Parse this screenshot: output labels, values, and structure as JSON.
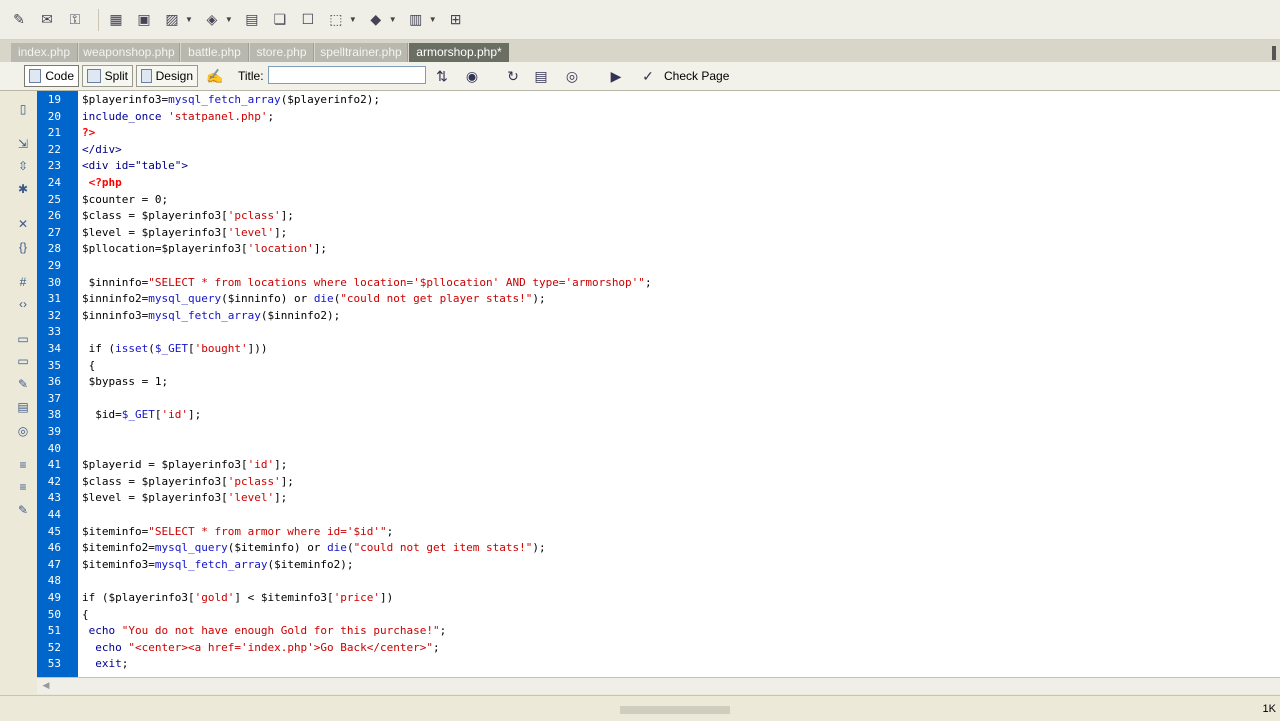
{
  "tabs": [
    {
      "label": "index.php"
    },
    {
      "label": "weaponshop.php"
    },
    {
      "label": "battle.php"
    },
    {
      "label": "store.php"
    },
    {
      "label": "spelltrainer.php"
    },
    {
      "label": "armorshop.php*"
    }
  ],
  "doc_toolbar": {
    "code_label": "Code",
    "split_label": "Split",
    "design_label": "Design",
    "title_label": "Title:",
    "title_value": "",
    "check_page_label": "Check Page"
  },
  "code": {
    "lines": [
      {
        "n": "19",
        "t": "$playerinfo3=mysql_fetch_array($playerinfo2);"
      },
      {
        "n": "20",
        "t": "include_once 'statpanel.php';"
      },
      {
        "n": "21",
        "t": "?>"
      },
      {
        "n": "22",
        "t": "</div>"
      },
      {
        "n": "23",
        "t": "<div id=\"table\">"
      },
      {
        "n": "24",
        "t": " <?php"
      },
      {
        "n": "25",
        "t": "$counter = 0;"
      },
      {
        "n": "26",
        "t": "$class = $playerinfo3['pclass'];"
      },
      {
        "n": "27",
        "t": "$level = $playerinfo3['level'];"
      },
      {
        "n": "28",
        "t": "$pllocation=$playerinfo3['location'];"
      },
      {
        "n": "29",
        "t": ""
      },
      {
        "n": "30",
        "t": " $inninfo=\"SELECT * from locations where location='$pllocation' AND type='armorshop'\";"
      },
      {
        "n": "31",
        "t": "$inninfo2=mysql_query($inninfo) or die(\"could not get player stats!\");"
      },
      {
        "n": "32",
        "t": "$inninfo3=mysql_fetch_array($inninfo2);"
      },
      {
        "n": "33",
        "t": ""
      },
      {
        "n": "34",
        "t": " if (isset($_GET['bought']))"
      },
      {
        "n": "35",
        "t": " {"
      },
      {
        "n": "36",
        "t": " $bypass = 1;"
      },
      {
        "n": "37",
        "t": ""
      },
      {
        "n": "38",
        "t": "  $id=$_GET['id'];"
      },
      {
        "n": "39",
        "t": ""
      },
      {
        "n": "40",
        "t": ""
      },
      {
        "n": "41",
        "t": "$playerid = $playerinfo3['id'];"
      },
      {
        "n": "42",
        "t": "$class = $playerinfo3['pclass'];"
      },
      {
        "n": "43",
        "t": "$level = $playerinfo3['level'];"
      },
      {
        "n": "44",
        "t": ""
      },
      {
        "n": "45",
        "t": "$iteminfo=\"SELECT * from armor where id='$id'\";"
      },
      {
        "n": "46",
        "t": "$iteminfo2=mysql_query($iteminfo) or die(\"could not get item stats!\");"
      },
      {
        "n": "47",
        "t": "$iteminfo3=mysql_fetch_array($iteminfo2);"
      },
      {
        "n": "48",
        "t": ""
      },
      {
        "n": "49",
        "t": "if ($playerinfo3['gold'] < $iteminfo3['price'])"
      },
      {
        "n": "50",
        "t": "{"
      },
      {
        "n": "51",
        "t": " echo \"You do not have enough Gold for this purchase!\";"
      },
      {
        "n": "52",
        "t": "  echo \"<center><a href='index.php'>Go Back</center>\";"
      },
      {
        "n": "53",
        "t": "  exit;"
      }
    ]
  },
  "status": {
    "size_text": "1K"
  },
  "colors": {
    "gutter": "#0066cc",
    "string": "#cc0000",
    "function": "#1515c8",
    "php_tag": "#ff0000"
  },
  "icons": {
    "top_toolbar": [
      "pencil-icon",
      "mail-icon",
      "lock-icon",
      "table-icon",
      "frame-icon",
      "image-icon",
      "widget-icon",
      "calendar-icon",
      "template-icon",
      "chat-icon",
      "cursor-icon",
      "tag-icon",
      "page-icon",
      "export-icon"
    ],
    "left_panel": [
      "file-icon",
      "collapse-icon",
      "expand-icon",
      "select-icon",
      "wrap-icon",
      "brace-icon",
      "highlight-icon",
      "code-icon",
      "comment-icon",
      "uncomment-icon",
      "wrap-tag-icon",
      "snippet-icon",
      "search-icon",
      "indent-icon",
      "outdent-icon",
      "format-icon"
    ]
  }
}
